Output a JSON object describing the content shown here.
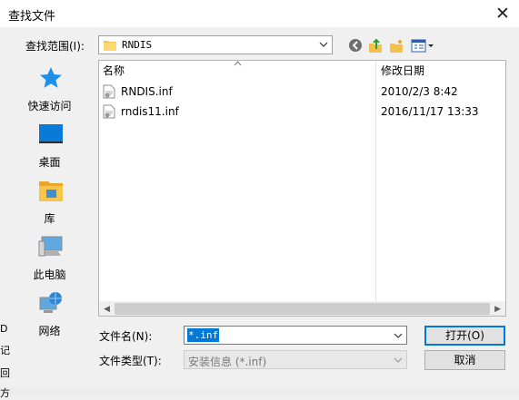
{
  "window": {
    "title": "查找文件"
  },
  "lookin": {
    "label": "查找范围(I):",
    "value": "RNDIS"
  },
  "places": [
    {
      "label": "快速访问",
      "icon": "star-icon"
    },
    {
      "label": "桌面",
      "icon": "desktop-icon"
    },
    {
      "label": "库",
      "icon": "library-folder-icon"
    },
    {
      "label": "此电脑",
      "icon": "computer-icon"
    },
    {
      "label": "网络",
      "icon": "network-icon"
    }
  ],
  "list": {
    "headers": {
      "name": "名称",
      "date": "修改日期"
    },
    "rows": [
      {
        "name": "RNDIS.inf",
        "date": "2010/2/3 8:42"
      },
      {
        "name": "rndis11.inf",
        "date": "2016/11/17 13:33"
      }
    ]
  },
  "filename": {
    "label": "文件名(N):",
    "value": "*.inf"
  },
  "filetype": {
    "label": "文件类型(T):",
    "value": "安装信息 (*.inf)"
  },
  "buttons": {
    "open": "打开(O)",
    "cancel": "取消"
  },
  "edge_fragments": [
    "D",
    "记",
    "回",
    "方"
  ]
}
